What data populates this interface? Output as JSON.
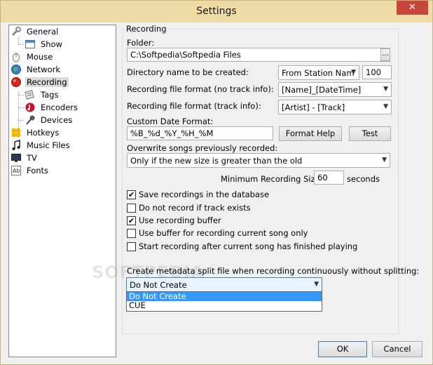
{
  "window": {
    "title": "Settings",
    "close_glyph": "✕"
  },
  "tree": {
    "items": [
      {
        "label": "General",
        "icon": "wrench-icon"
      },
      {
        "label": "Show",
        "icon": "window-icon"
      },
      {
        "label": "Mouse",
        "icon": "mouse-icon"
      },
      {
        "label": "Network",
        "icon": "globe-icon"
      },
      {
        "label": "Recording",
        "icon": "record-icon"
      },
      {
        "label": "Tags",
        "icon": "tag-icon"
      },
      {
        "label": "Encoders",
        "icon": "music-disc-icon"
      },
      {
        "label": "Devices",
        "icon": "microphone-icon"
      },
      {
        "label": "Hotkeys",
        "icon": "hotkeys-icon"
      },
      {
        "label": "Music Files",
        "icon": "music-note-icon"
      },
      {
        "label": "TV",
        "icon": "tv-icon"
      },
      {
        "label": "Fonts",
        "icon": "fonts-icon"
      }
    ]
  },
  "recording": {
    "group_title": "Recording",
    "folder_label": "Folder:",
    "folder_value": "C:\\Softpedia\\Softpedia Files",
    "browse_label": "...",
    "dirname_label": "Directory name to be created:",
    "dirname_value": "From Station Nam",
    "dirname_number": "100",
    "format_notrack_label": "Recording file format (no track info):",
    "format_notrack_value": "[Name]_[DateTime]",
    "format_track_label": "Recording file format (track info):",
    "format_track_value": "[Artist] - [Track]",
    "date_format_label": "Custom Date Format:",
    "date_format_value": "%B_%d_%Y_%H_%M",
    "format_help_label": "Format Help",
    "test_label": "Test",
    "overwrite_label": "Overwrite songs previously recorded:",
    "overwrite_value": "Only if the new size is greater than the old",
    "min_size_label": "Minimum Recording Size:",
    "min_size_value": "60",
    "min_size_unit": "seconds",
    "checkboxes": [
      {
        "label": "Save recordings in the database",
        "checked": true
      },
      {
        "label": "Do not record if track exists",
        "checked": false
      },
      {
        "label": "Use recording buffer",
        "checked": true
      },
      {
        "label": "Use buffer for recording current song only",
        "checked": false
      },
      {
        "label": "Start recording after current song has finished playing",
        "checked": false
      }
    ],
    "split_label": "Create metadata split file when recording continuously without splitting:",
    "split_value": "Do Not Create",
    "split_options": [
      "Do Not Create",
      "CUE"
    ]
  },
  "buttons": {
    "ok": "OK",
    "cancel": "Cancel"
  },
  "watermark": "SOFTPEDIA",
  "colors": {
    "titlebar": "#efdba6",
    "close": "#c7463a",
    "highlight": "#3399ff"
  }
}
